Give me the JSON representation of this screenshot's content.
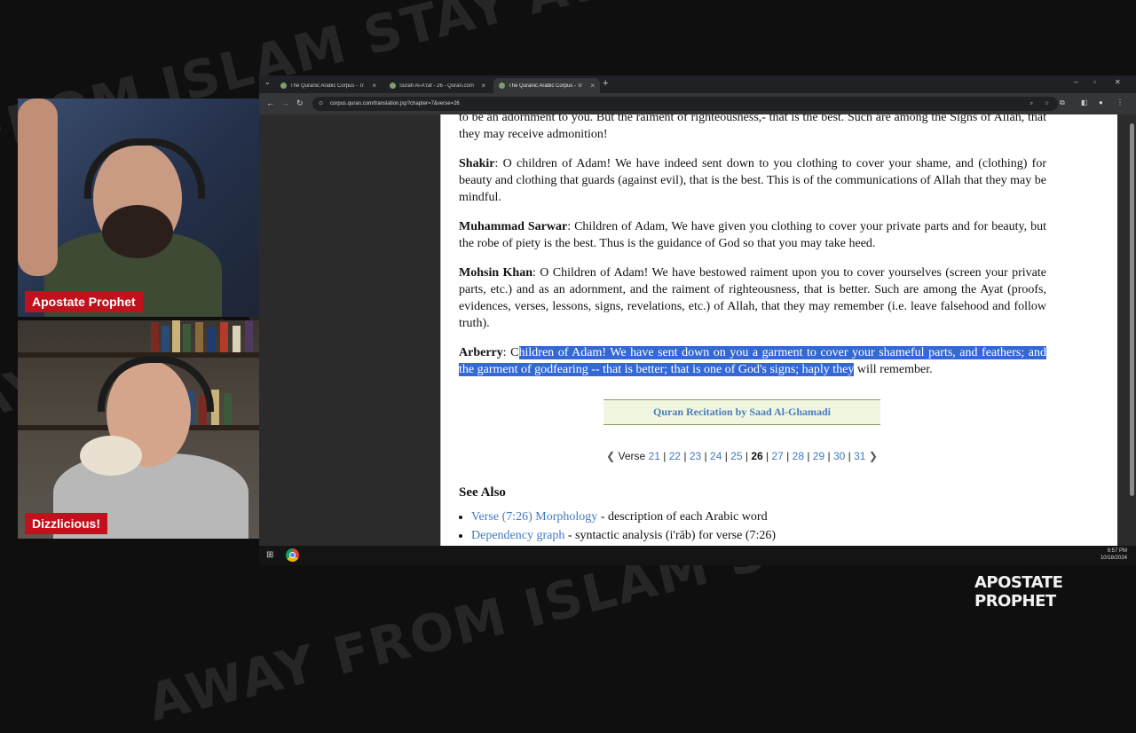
{
  "background": {
    "watermark_lines": [
      "FROM ISLAM STAY AWAY FROM ISLAM STAY AWAY",
      "STAY AWAY FROM ISLAM STAY AWAY FROM ISLAM",
      "AWAY FROM ISLAM STAY AWAY FROM ISLAM STAY"
    ]
  },
  "webcams": {
    "top_name": "Apostate Prophet",
    "bottom_name": "Dizzlicious!"
  },
  "browser": {
    "tabs": [
      {
        "title": "The Quranic Arabic Corpus - Tr",
        "active": false
      },
      {
        "title": "Surah Al-A'raf - 26 - Quran.com",
        "active": false
      },
      {
        "title": "The Quranic Arabic Corpus - Tr",
        "active": true
      }
    ],
    "new_tab": "+",
    "url": "corpus.quran.com/translation.jsp?chapter=7&verse=26"
  },
  "page": {
    "lead_text": "to be an adornment to you. But the raiment of righteousness,- that is the best. Such are among the Signs of Allah, that they may receive admonition!",
    "translations": [
      {
        "name": "Shakir",
        "text": ": O children of Adam! We have indeed sent down to you clothing to cover your shame, and (clothing) for beauty and clothing that guards (against evil), that is the best. This is of the communications of Allah that they may be mindful."
      },
      {
        "name": "Muhammad Sarwar",
        "text": ": Children of Adam, We have given you clothing to cover your private parts and for beauty, but the robe of piety is the best. Thus is the guidance of God so that you may take heed."
      },
      {
        "name": "Mohsin Khan",
        "text": ": O Children of Adam! We have bestowed raiment upon you to cover yourselves (screen your private parts, etc.) and as an adornment, and the raiment of righteousness, that is better. Such are among the Ayat (proofs, evidences, verses, lessons, signs, revelations, etc.) of Allah, that they may remember (i.e. leave falsehood and follow truth)."
      }
    ],
    "arberry": {
      "name": "Arberry",
      "pre": ": C",
      "highlighted": "hildren of Adam! We have sent down on you a garment to cover your shameful parts, and feathers; and the garment of godfearing -- that is better; that is one of God's signs; haply they",
      "post": " will remember."
    },
    "recitation_label": "Quran Recitation by Saad Al-Ghamadi",
    "verse_nav": {
      "label": "Verse",
      "verses": [
        "21",
        "22",
        "23",
        "24",
        "25",
        "26",
        "27",
        "28",
        "29",
        "30",
        "31"
      ],
      "current": "26"
    },
    "see_also": {
      "heading": "See Also",
      "items": [
        {
          "link": "Verse (7:26) Morphology",
          "desc": " - description of each Arabic word"
        },
        {
          "link": "Dependency graph",
          "desc": " - syntactic analysis (i'rāb) for verse (7:26)"
        }
      ]
    }
  },
  "taskbar": {
    "time": "9:57 PM",
    "date": "10/18/2024"
  },
  "logo": "APOSTATE PROPHET"
}
